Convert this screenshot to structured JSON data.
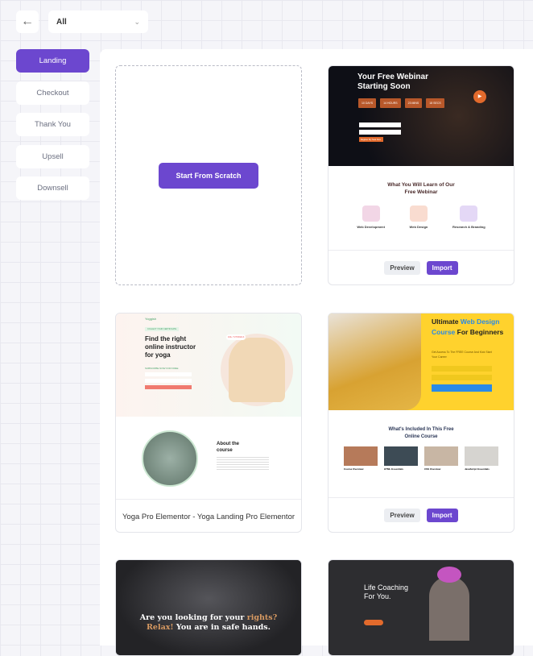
{
  "toolbar": {
    "back_icon": "arrow-left-icon",
    "filter_value": "All",
    "chevron": "chevron-down-icon"
  },
  "sidebar": {
    "items": [
      {
        "label": "Landing",
        "active": true
      },
      {
        "label": "Checkout"
      },
      {
        "label": "Thank You"
      },
      {
        "label": "Upsell"
      },
      {
        "label": "Downsell"
      }
    ]
  },
  "accent": "#6c47cf",
  "scratch": {
    "label": "Start From Scratch"
  },
  "cards": [
    {
      "preview_label": "Preview",
      "import_label": "Import",
      "hero_title": "Your Free Webinar Starting Soon",
      "countdown": [
        "10 DAYS",
        "14 HOURS",
        "23 MINS",
        "18 SECS"
      ],
      "cta": "Register My Seat Now",
      "section_title": "What You Will Learn of Our Free Webinar",
      "features": [
        "Web Development",
        "Web Design",
        "Research & Branding"
      ]
    },
    {
      "title": "Yoga Pro Elementor - Yoga Landing Pro Elementor",
      "brand": "Yoggish",
      "badge": "COLLECT YOUR CERTIFICATE",
      "hero_title": "Find the right online instructor for yoga",
      "subscribe": "SUBSCRIBE NOW FOR FREE",
      "stat": "100+ TUTORIALS",
      "about": "About the course"
    },
    {
      "preview_label": "Preview",
      "import_label": "Import",
      "hero_title_1": "Ultimate ",
      "hero_title_2": "Web Design Course",
      "hero_title_3": " For Beginners",
      "hero_sub": "Get Access To The FREE Course And Kick Start Your Career",
      "section_title": "What's Included In This Free Online Course",
      "lessons": [
        "Course Overview",
        "HTML Essentials",
        "CSS Overview",
        "JavaScript Essentials"
      ]
    },
    {
      "hero_1": "Are you looking for your ",
      "hero_2": "rights?",
      "hero_3": "Relax!",
      "hero_4": " You are in safe hands."
    },
    {
      "hero": "Life Coaching For You."
    }
  ]
}
